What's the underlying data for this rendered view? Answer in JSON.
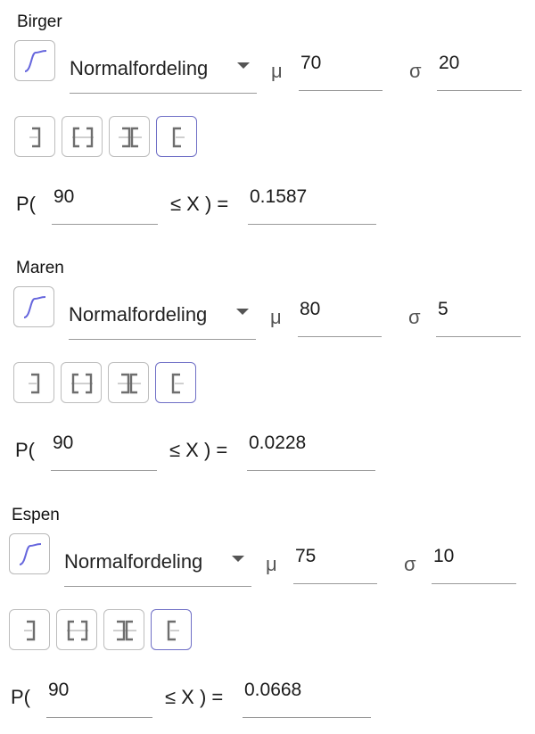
{
  "distribution_options": {
    "selected": "Normalfordeling",
    "curve_icon": "normal-curve-icon"
  },
  "symbols": {
    "mu": "μ",
    "sigma": "σ",
    "prob_prefix": "P(",
    "prob_middle": "≤ X ) ="
  },
  "interval_buttons": [
    {
      "name": "left-sided",
      "icon": "left-sided-interval-icon",
      "active": false
    },
    {
      "name": "two-sided",
      "icon": "interval-icon",
      "active": false
    },
    {
      "name": "two-tailed",
      "icon": "two-tailed-icon",
      "active": false
    },
    {
      "name": "right-sided",
      "icon": "right-sided-interval-icon",
      "active": true
    }
  ],
  "colors": {
    "accent": "#6f6fc6",
    "curve": "#6666dd"
  },
  "sections": [
    {
      "title": "Birger",
      "mu": "70",
      "sigma": "20",
      "lower": "90",
      "result": "0.1587"
    },
    {
      "title": "Maren",
      "mu": "80",
      "sigma": "5",
      "lower": "90",
      "result": "0.0228"
    },
    {
      "title": "Espen",
      "mu": "75",
      "sigma": "10",
      "lower": "90",
      "result": "0.0668"
    }
  ]
}
